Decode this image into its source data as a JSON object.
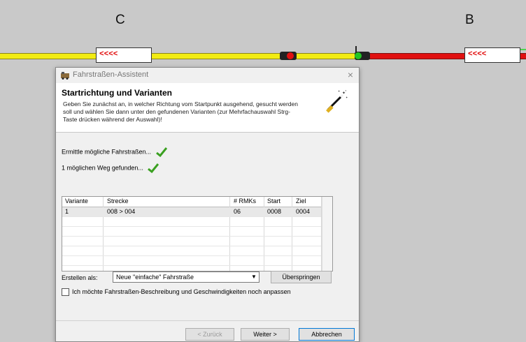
{
  "layout_labels": {
    "left": "C",
    "right": "B"
  },
  "blocks": [
    {
      "text": "<<<<"
    },
    {
      "text": "<<<<"
    }
  ],
  "dialog": {
    "title": "Fahrstraßen-Assistent",
    "close_glyph": "×",
    "header_title": "Startrichtung und Varianten",
    "header_desc": "Geben Sie zunächst an, in welcher Richtung vom Startpunkt ausgehend, gesucht werden soll und wählen Sie dann unter den gefundenen Varianten (zur Mehrfachauswahl Strg-Taste drücken während der Auswahl)!",
    "status": [
      "Ermittle mögliche Fahrstraßen...",
      "1 möglichen Weg gefunden..."
    ],
    "table": {
      "headers": [
        "Variante",
        "Strecke",
        "# RMKs",
        "Start",
        "Ziel"
      ],
      "rows": [
        [
          "1",
          "008 > 004",
          "06",
          "0008",
          "0004"
        ]
      ]
    },
    "create_label": "Erstellen als:",
    "create_select": "Neue \"einfache\" Fahrstraße",
    "skip_button": "Überspringen",
    "checkbox_label": "Ich möchte Fahrstraßen-Beschreibung und Geschwindigkeiten noch anpassen",
    "back_button": "< Zurück",
    "next_button": "Weiter >",
    "cancel_button": "Abbrechen"
  },
  "colors": {
    "track_yellow": "#f2ec12",
    "track_red": "#e01010",
    "block_text": "#e00000"
  },
  "icons": [
    "app-icon",
    "magic-wand-icon",
    "checkmark-icon",
    "dropdown-arrow-icon",
    "close-icon"
  ]
}
